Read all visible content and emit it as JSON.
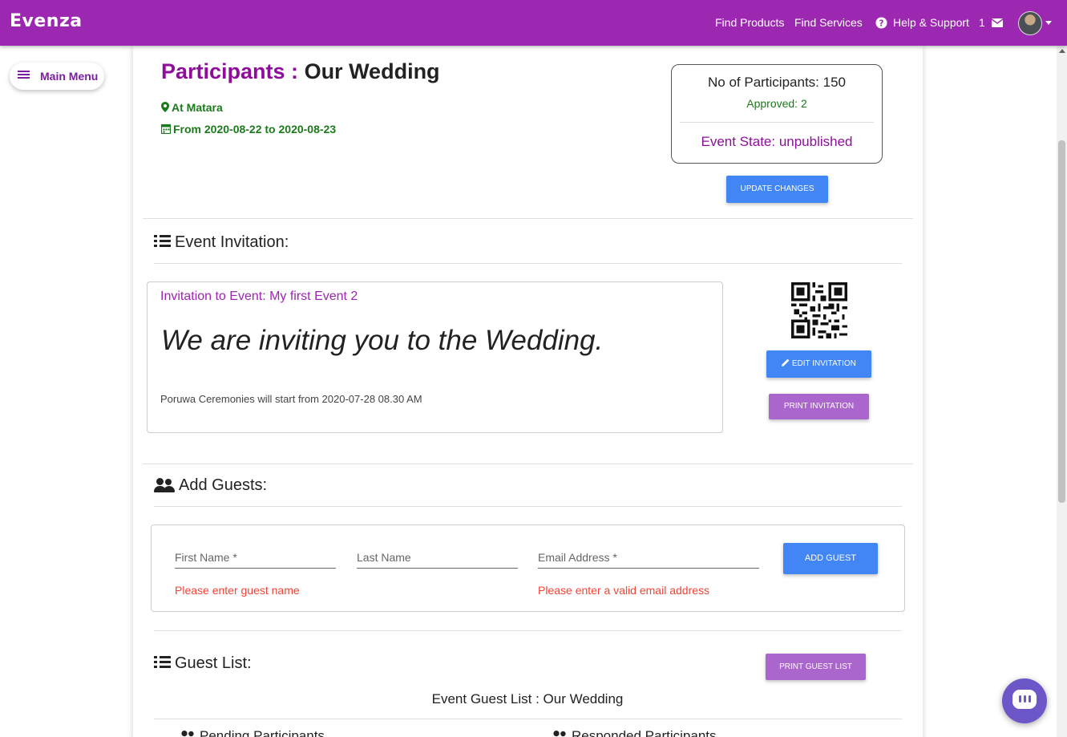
{
  "navbar": {
    "brand": "Evenza",
    "find_products": "Find Products",
    "find_services": "Find Services",
    "help": "Help & Support",
    "notification_count": "1"
  },
  "menu": {
    "label": "Main Menu"
  },
  "event": {
    "title_prefix": "Participants :",
    "title": "Our Wedding",
    "location": "At Matara",
    "dates": "From 2020-08-22 to 2020-08-23"
  },
  "stats": {
    "participants": "No of Participants: 150",
    "approved": "Approved: 2",
    "state": "Event State: unpublished"
  },
  "buttons": {
    "update": "Update Changes",
    "edit_invitation": "Edit Invitation",
    "print_invitation": "Print Invitation",
    "add_guest": "Add Guest",
    "print_guest_list": "Print Guest List"
  },
  "invitation": {
    "section_title": "Event Invitation:",
    "title": "Invitation to Event: My first Event 2",
    "heading": "We are inviting you to the Wedding.",
    "body": "Poruwa Ceremonies will start from 2020-07-28 08.30 AM"
  },
  "guests": {
    "section_title": "Add Guests:",
    "first_name_placeholder": "First Name *",
    "last_name_placeholder": "Last Name",
    "email_placeholder": "Email Address *",
    "first_name_error": "Please enter guest name",
    "email_error": "Please enter a valid email address"
  },
  "guest_list": {
    "section_title": "Guest List:",
    "title": "Event Guest List : Our Wedding",
    "pending": "Pending Participants",
    "responded": "Responded Participants"
  },
  "colors": {
    "brand": "#9c27b0",
    "primary_button": "#4285f4",
    "secondary_button": "#aa66cc",
    "success": "#1b7a1b",
    "error": "#f44336"
  }
}
